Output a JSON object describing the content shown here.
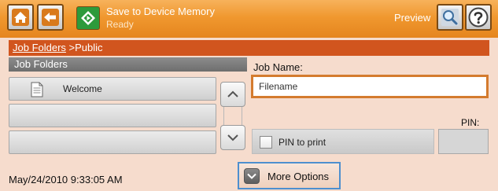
{
  "header": {
    "job_title": "Save to Device Memory",
    "job_status": "Ready",
    "preview_label": "Preview",
    "icons": {
      "home": "home-icon",
      "back": "back-arrow-icon",
      "start": "start-icon",
      "preview": "magnifier-icon",
      "help": "help-icon"
    }
  },
  "path": {
    "root_link": "Job Folders",
    "separator": " >",
    "current": "Public"
  },
  "folder_list": {
    "header": "Job Folders",
    "items": [
      {
        "label": "Welcome",
        "icon": "document-icon"
      },
      {
        "label": ""
      },
      {
        "label": ""
      }
    ]
  },
  "job_name": {
    "label": "Job Name:",
    "value": "Filename"
  },
  "pin": {
    "label": "PIN:",
    "checkbox_label": "PIN to print",
    "checked": false,
    "value": ""
  },
  "footer": {
    "timestamp": "May/24/2010 9:33:05 AM",
    "more_options_label": "More Options"
  },
  "colors": {
    "header_orange": "#f0982f",
    "path_bar": "#d1551e",
    "input_border": "#d47b2e",
    "background": "#f6dccd",
    "start_green": "#2d9a3b",
    "focus_blue": "#4d8fcf"
  }
}
